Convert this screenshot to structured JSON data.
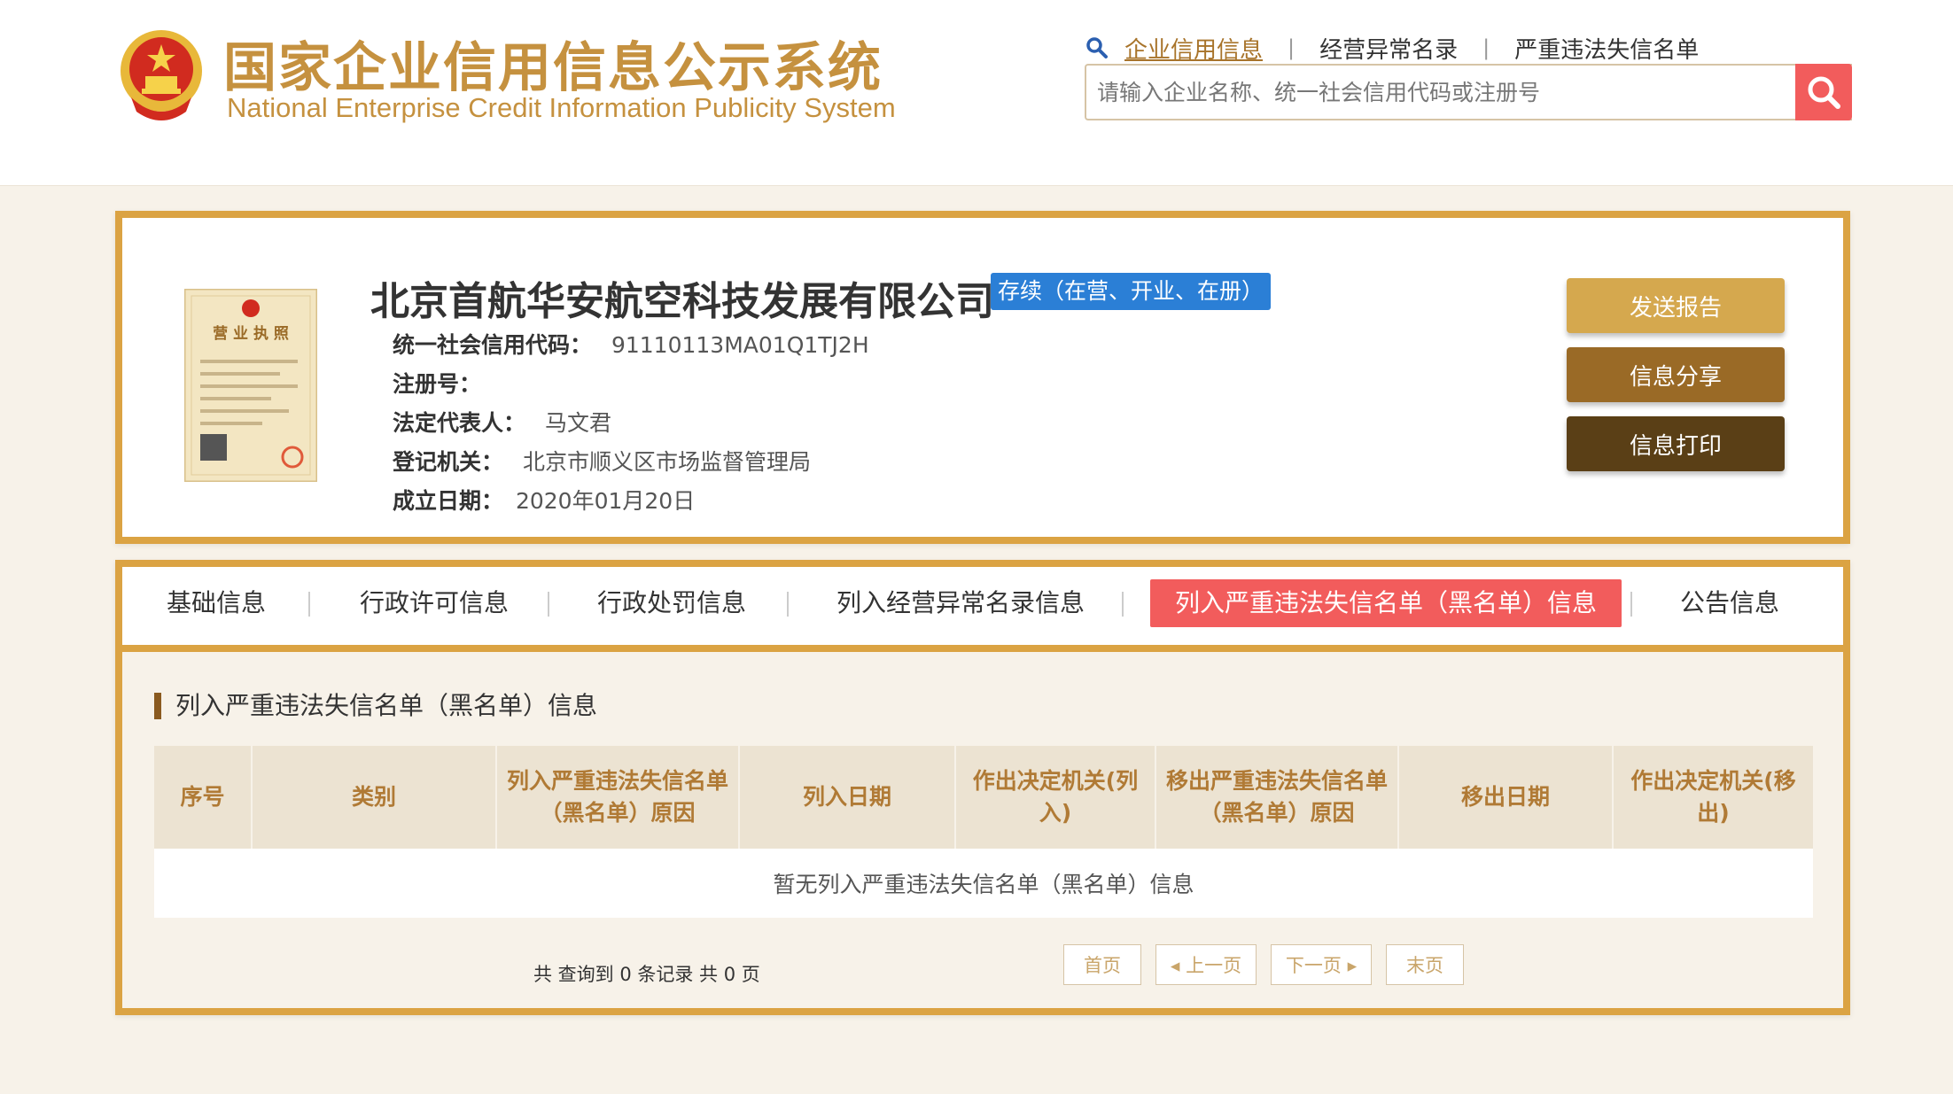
{
  "header": {
    "title_cn": "国家企业信用信息公示系统",
    "title_en": "National Enterprise Credit Information Publicity System",
    "nav": [
      {
        "label": "企业信用信息",
        "active": true
      },
      {
        "label": "经营异常名录",
        "active": false
      },
      {
        "label": "严重违法失信名单",
        "active": false
      }
    ],
    "search_placeholder": "请输入企业名称、统一社会信用代码或注册号"
  },
  "company": {
    "name": "北京首航华安航空科技发展有限公司",
    "status": "存续（在营、开业、在册）",
    "license_title": "营 业 执 照",
    "fields": [
      {
        "label": "统一社会信用代码：",
        "value": "91110113MA01Q1TJ2H"
      },
      {
        "label": "注册号：",
        "value": ""
      },
      {
        "label": "法定代表人：",
        "value": "马文君"
      },
      {
        "label": "登记机关：",
        "value": "北京市顺义区市场监督管理局"
      },
      {
        "label": "成立日期：",
        "value": "2020年01月20日"
      }
    ],
    "actions": {
      "report": "发送报告",
      "share": "信息分享",
      "print": "信息打印"
    }
  },
  "tabs": [
    {
      "label": "基础信息",
      "active": false
    },
    {
      "label": "行政许可信息",
      "active": false
    },
    {
      "label": "行政处罚信息",
      "active": false
    },
    {
      "label": "列入经营异常名录信息",
      "active": false
    },
    {
      "label": "列入严重违法失信名单（黑名单）信息",
      "active": true
    },
    {
      "label": "公告信息",
      "active": false
    }
  ],
  "section": {
    "title": "列入严重违法失信名单（黑名单）信息",
    "columns": [
      "序号",
      "类别",
      "列入严重违法失信名单（黑名单）原因",
      "列入日期",
      "作出决定机关(列入)",
      "移出严重违法失信名单（黑名单）原因",
      "移出日期",
      "作出决定机关(移出)"
    ],
    "empty_text": "暂无列入严重违法失信名单（黑名单）信息"
  },
  "pager": {
    "summary": "共 查询到 0 条记录 共 0 页",
    "first": "首页",
    "prev": "上一页",
    "next": "下一页",
    "last": "末页"
  },
  "colors": {
    "gold": "#dba343",
    "red": "#f25c5c",
    "badge_blue": "#2b7fd6"
  }
}
